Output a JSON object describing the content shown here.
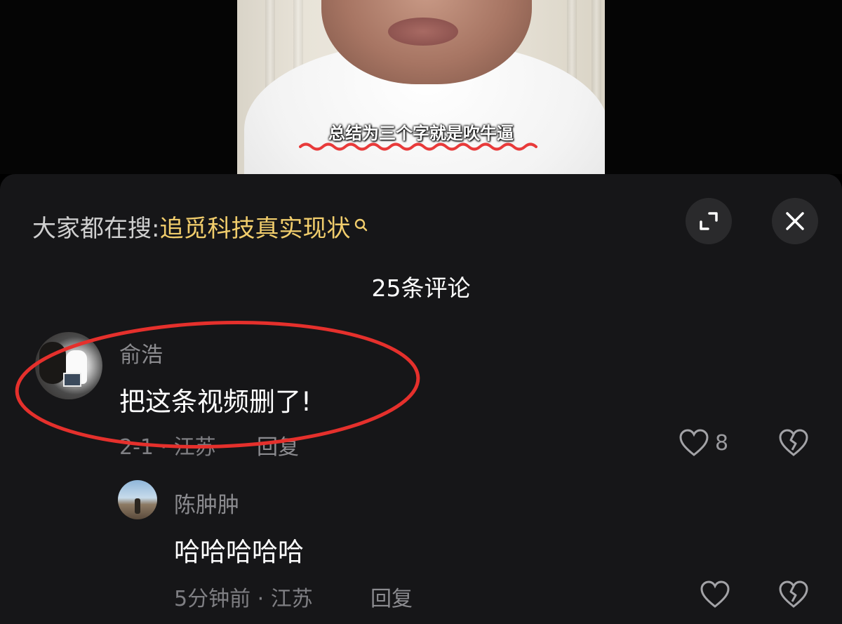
{
  "video": {
    "subtitle": "总结为三个字就是吹牛逼",
    "colors": {
      "subtitle_underline": "#e83a3a"
    }
  },
  "panel": {
    "search_prefix": "大家都在搜:",
    "search_term": "追觅科技真实现状",
    "search_icon": "search-icon",
    "expand_icon": "expand-icon",
    "close_icon": "close-icon",
    "comment_count": "25条评论",
    "colors": {
      "search_term": "#f1cd6c",
      "panel_bg": "#161618"
    }
  },
  "comments": [
    {
      "author": "俞浩",
      "text": "把这条视频删了!",
      "meta": "2-1 · 江苏",
      "reply_label": "回复",
      "likes": "8",
      "annotation": "red-ellipse-highlight"
    }
  ],
  "replies": [
    {
      "author": "陈肿肿",
      "text": "哈哈哈哈哈",
      "meta": "5分钟前 · 江苏",
      "reply_label": "回复"
    }
  ]
}
